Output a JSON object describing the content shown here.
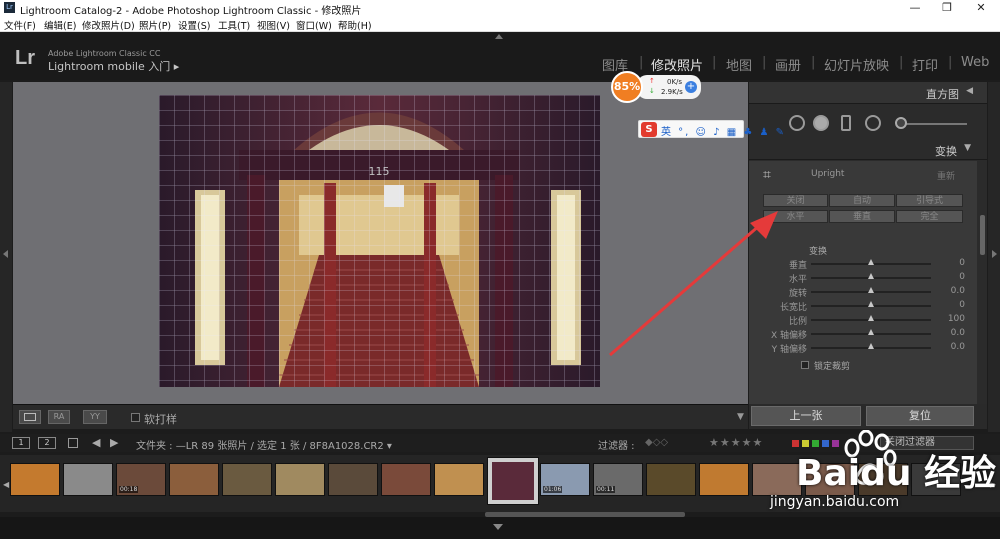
{
  "window": {
    "title": "Lightroom Catalog-2 - Adobe Photoshop Lightroom Classic - 修改照片",
    "app_icon": "Lr",
    "minimize": "—",
    "maximize": "❐",
    "close": "✕"
  },
  "menu": [
    "文件(F)",
    "编辑(E)",
    "修改照片(D)",
    "照片(P)",
    "设置(S)",
    "工具(T)",
    "视图(V)",
    "窗口(W)",
    "帮助(H)"
  ],
  "identity": {
    "logo": "Lr",
    "line1": "Adobe Lightroom Classic CC",
    "line2": "Lightroom mobile 入门 ▸"
  },
  "modules": [
    {
      "label": "图库",
      "active": false
    },
    {
      "label": "修改照片",
      "active": true
    },
    {
      "label": "地图",
      "active": false
    },
    {
      "label": "画册",
      "active": false
    },
    {
      "label": "幻灯片放映",
      "active": false
    },
    {
      "label": "打印",
      "active": false
    },
    {
      "label": "Web",
      "active": false
    }
  ],
  "photo": {
    "number_sign": "115",
    "icon": "staircase-photo"
  },
  "toolbar": {
    "view_btn1": "",
    "view_btn2": "RA",
    "view_btn3": "YY",
    "softproof_label": "软打样"
  },
  "right_panel": {
    "histogram_title": "直方图",
    "transform_title": "变换",
    "upright_label": "Upright",
    "upright_reset": "重新",
    "upright_buttons_row1": [
      "关闭",
      "自动",
      "引导式"
    ],
    "upright_buttons_row2": [
      "水平",
      "垂直",
      "完全"
    ],
    "transform_section": "变换",
    "sliders": [
      {
        "label": "垂直",
        "value": "0"
      },
      {
        "label": "水平",
        "value": "0"
      },
      {
        "label": "旋转",
        "value": "0.0"
      },
      {
        "label": "长宽比",
        "value": "0"
      },
      {
        "label": "比例",
        "value": "100"
      },
      {
        "label": "X 轴偏移",
        "value": "0.0"
      },
      {
        "label": "Y 轴偏移",
        "value": "0.0"
      }
    ],
    "lock_crop_label": "锁定裁剪",
    "prev_button": "上一张",
    "reset_button": "复位"
  },
  "filmstrip_bar": {
    "page1": "1",
    "page2": "2",
    "source": "文件夹 : —LR   89 张照片 / 选定 1 张 / 8F8A1028.CR2 ▾",
    "filter_label": "过滤器 :",
    "stars": "★★★★★",
    "filter_dropdown": "关闭过滤器"
  },
  "filmstrip": {
    "thumbs": [
      {
        "color": "#c47a2e",
        "tc": ""
      },
      {
        "color": "#8a8a8a",
        "tc": ""
      },
      {
        "color": "#6b4a3a",
        "tc": "00:18"
      },
      {
        "color": "#8b5e3c",
        "tc": ""
      },
      {
        "color": "#6a5a40",
        "tc": ""
      },
      {
        "color": "#a08a60",
        "tc": ""
      },
      {
        "color": "#5a4a3a",
        "tc": ""
      },
      {
        "color": "#7a4a3a",
        "tc": ""
      },
      {
        "color": "#c09050",
        "tc": ""
      },
      {
        "color": "#5a2a3a",
        "tc": ""
      },
      {
        "color": "#8a9ab0",
        "tc": "01:06"
      },
      {
        "color": "#6a6a6a",
        "tc": "00:11"
      },
      {
        "color": "#5a4a2a",
        "tc": ""
      },
      {
        "color": "#c07a30",
        "tc": ""
      },
      {
        "color": "#8a6a5a",
        "tc": ""
      },
      {
        "color": "#7a5a4a",
        "tc": ""
      },
      {
        "color": "#4a3a2a",
        "tc": ""
      },
      {
        "color": "#3a3a3a",
        "tc": ""
      }
    ],
    "selected_index": 9
  },
  "overlays": {
    "cpu_percent": "85%",
    "upload_speed": "0K/s",
    "download_speed": "2.9K/s",
    "ime_logo": "S",
    "ime_items": "英 °, ☺ ♪ ▦ ♣ ♟ ✎",
    "watermark_name": "Baidu 经验",
    "watermark_url": "jingyan.baidu.com"
  },
  "colors": {
    "active_module": "#e5e5e5",
    "inactive_module": "#8c8c8c",
    "arrow": "#e53a3a",
    "cpu_orange": "#f07e22"
  }
}
